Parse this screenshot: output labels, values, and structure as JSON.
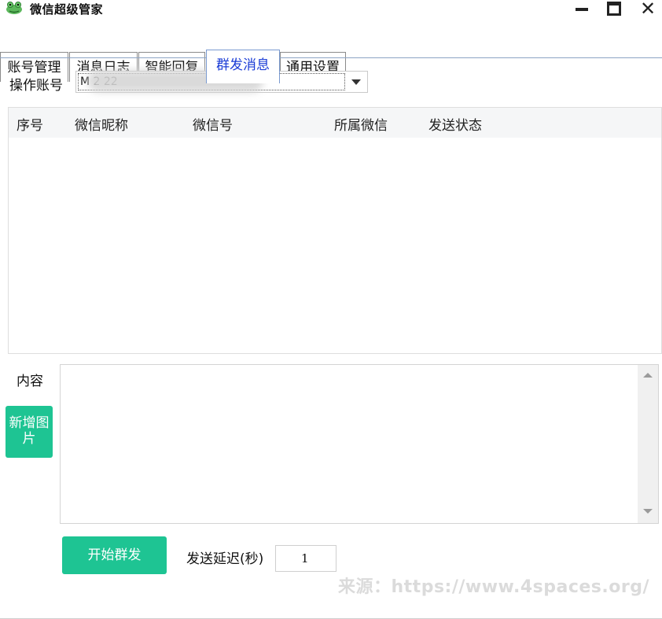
{
  "window": {
    "title": "微信超级管家",
    "icon": "frog-icon"
  },
  "tabs": [
    {
      "label": "账号管理",
      "active": false
    },
    {
      "label": "消息日志",
      "active": false
    },
    {
      "label": "智能回复",
      "active": false
    },
    {
      "label": "群发消息",
      "active": true
    },
    {
      "label": "通用设置",
      "active": false
    }
  ],
  "account": {
    "label": "操作账号",
    "value_visible": "M                              2  22"
  },
  "table": {
    "columns": [
      "序号",
      "微信昵称",
      "微信号",
      "所属微信",
      "发送状态"
    ],
    "rows": []
  },
  "content": {
    "label": "内容",
    "value": ""
  },
  "buttons": {
    "add_image": "新增图片",
    "start_send": "开始群发"
  },
  "delay": {
    "label": "发送延迟(秒)",
    "value": "1"
  },
  "watermark": "来源：https://www.4spaces.org/",
  "colors": {
    "accent_green": "#1ec493",
    "active_tab_text": "#1a3cd6"
  }
}
